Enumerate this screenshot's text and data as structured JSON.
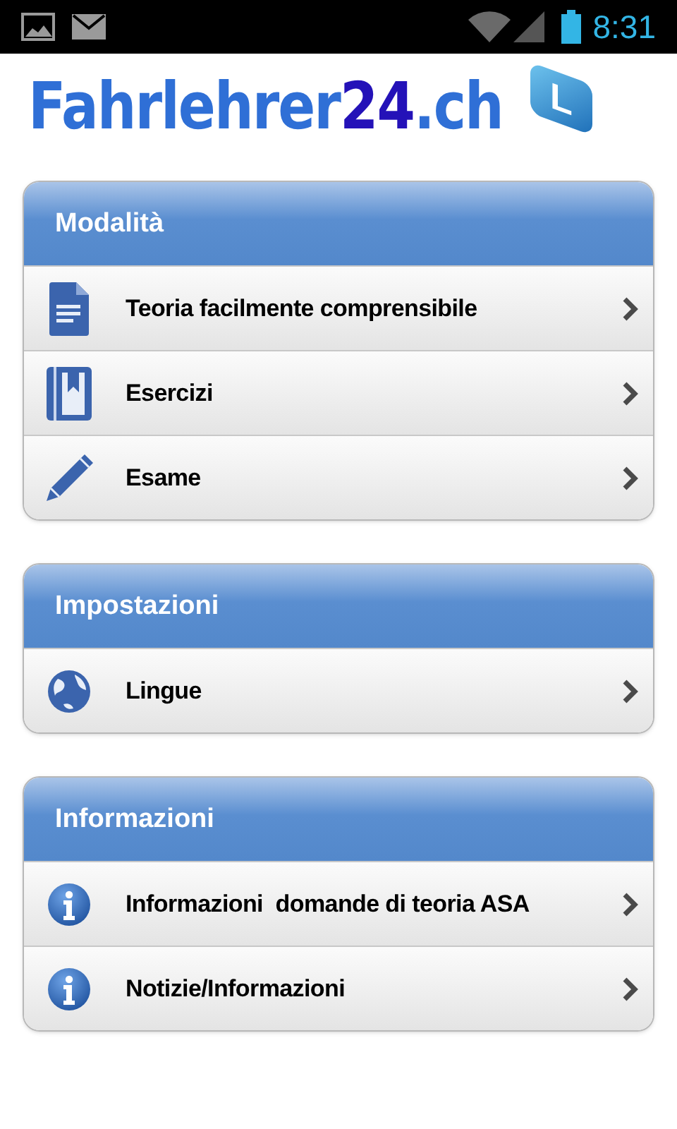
{
  "status_bar": {
    "time": "8:31"
  },
  "logo": {
    "text": "Fahrlehrer",
    "accent": "24",
    "suffix": ".ch",
    "badge": "L"
  },
  "sections": [
    {
      "title": "Modalità",
      "items": [
        {
          "kind": "document",
          "label": "Teoria facilmente comprensibile"
        },
        {
          "kind": "bookmark",
          "label": "Esercizi"
        },
        {
          "kind": "pencil",
          "label": "Esame"
        }
      ]
    },
    {
      "title": "Impostazioni",
      "items": [
        {
          "kind": "globe",
          "label": "Lingue"
        }
      ]
    },
    {
      "title": "Informazioni",
      "items": [
        {
          "kind": "info",
          "label": "Informazioni  domande di teoria ASA"
        },
        {
          "kind": "info",
          "label": "Notizie/Informazioni"
        }
      ]
    }
  ]
}
